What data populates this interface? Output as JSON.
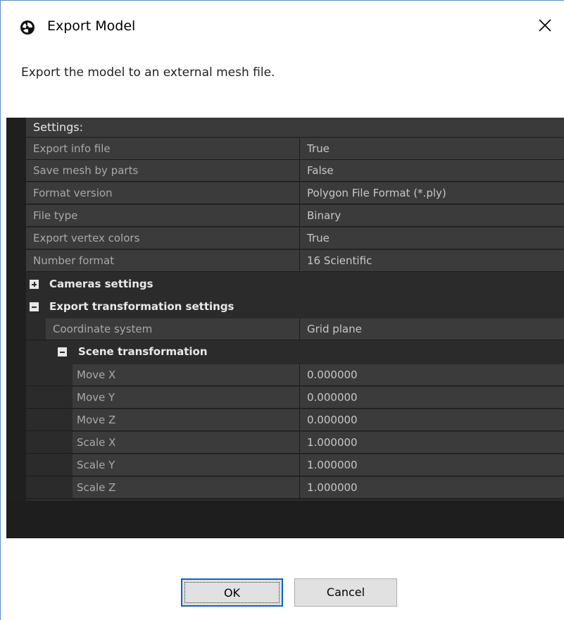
{
  "window": {
    "title": "Export Model",
    "close_icon": "close-icon",
    "app_icon": "app-logo-icon"
  },
  "description": "Export the model to an external mesh file.",
  "settings": {
    "header": "Settings:",
    "rows": [
      {
        "label": "Export info file",
        "value": "True"
      },
      {
        "label": "Save mesh by parts",
        "value": "False"
      },
      {
        "label": "Format version",
        "value": "Polygon File Format (*.ply)"
      },
      {
        "label": "File type",
        "value": "Binary"
      },
      {
        "label": "Export vertex colors",
        "value": "True"
      },
      {
        "label": "Number format",
        "value": "16 Scientific"
      }
    ],
    "cameras_group": {
      "label": "Cameras settings",
      "expanded": false
    },
    "transform_group": {
      "label": "Export transformation settings",
      "expanded": true,
      "coordinate_system": {
        "label": "Coordinate system",
        "value": "Grid plane"
      },
      "scene_group": {
        "label": "Scene transformation",
        "expanded": true,
        "rows": [
          {
            "label": "Move X",
            "value": "0.000000"
          },
          {
            "label": "Move Y",
            "value": "0.000000"
          },
          {
            "label": "Move Z",
            "value": "0.000000"
          },
          {
            "label": "Scale X",
            "value": "1.000000"
          },
          {
            "label": "Scale Y",
            "value": "1.000000"
          },
          {
            "label": "Scale Z",
            "value": "1.000000"
          }
        ]
      }
    }
  },
  "buttons": {
    "ok": "OK",
    "cancel": "Cancel"
  }
}
